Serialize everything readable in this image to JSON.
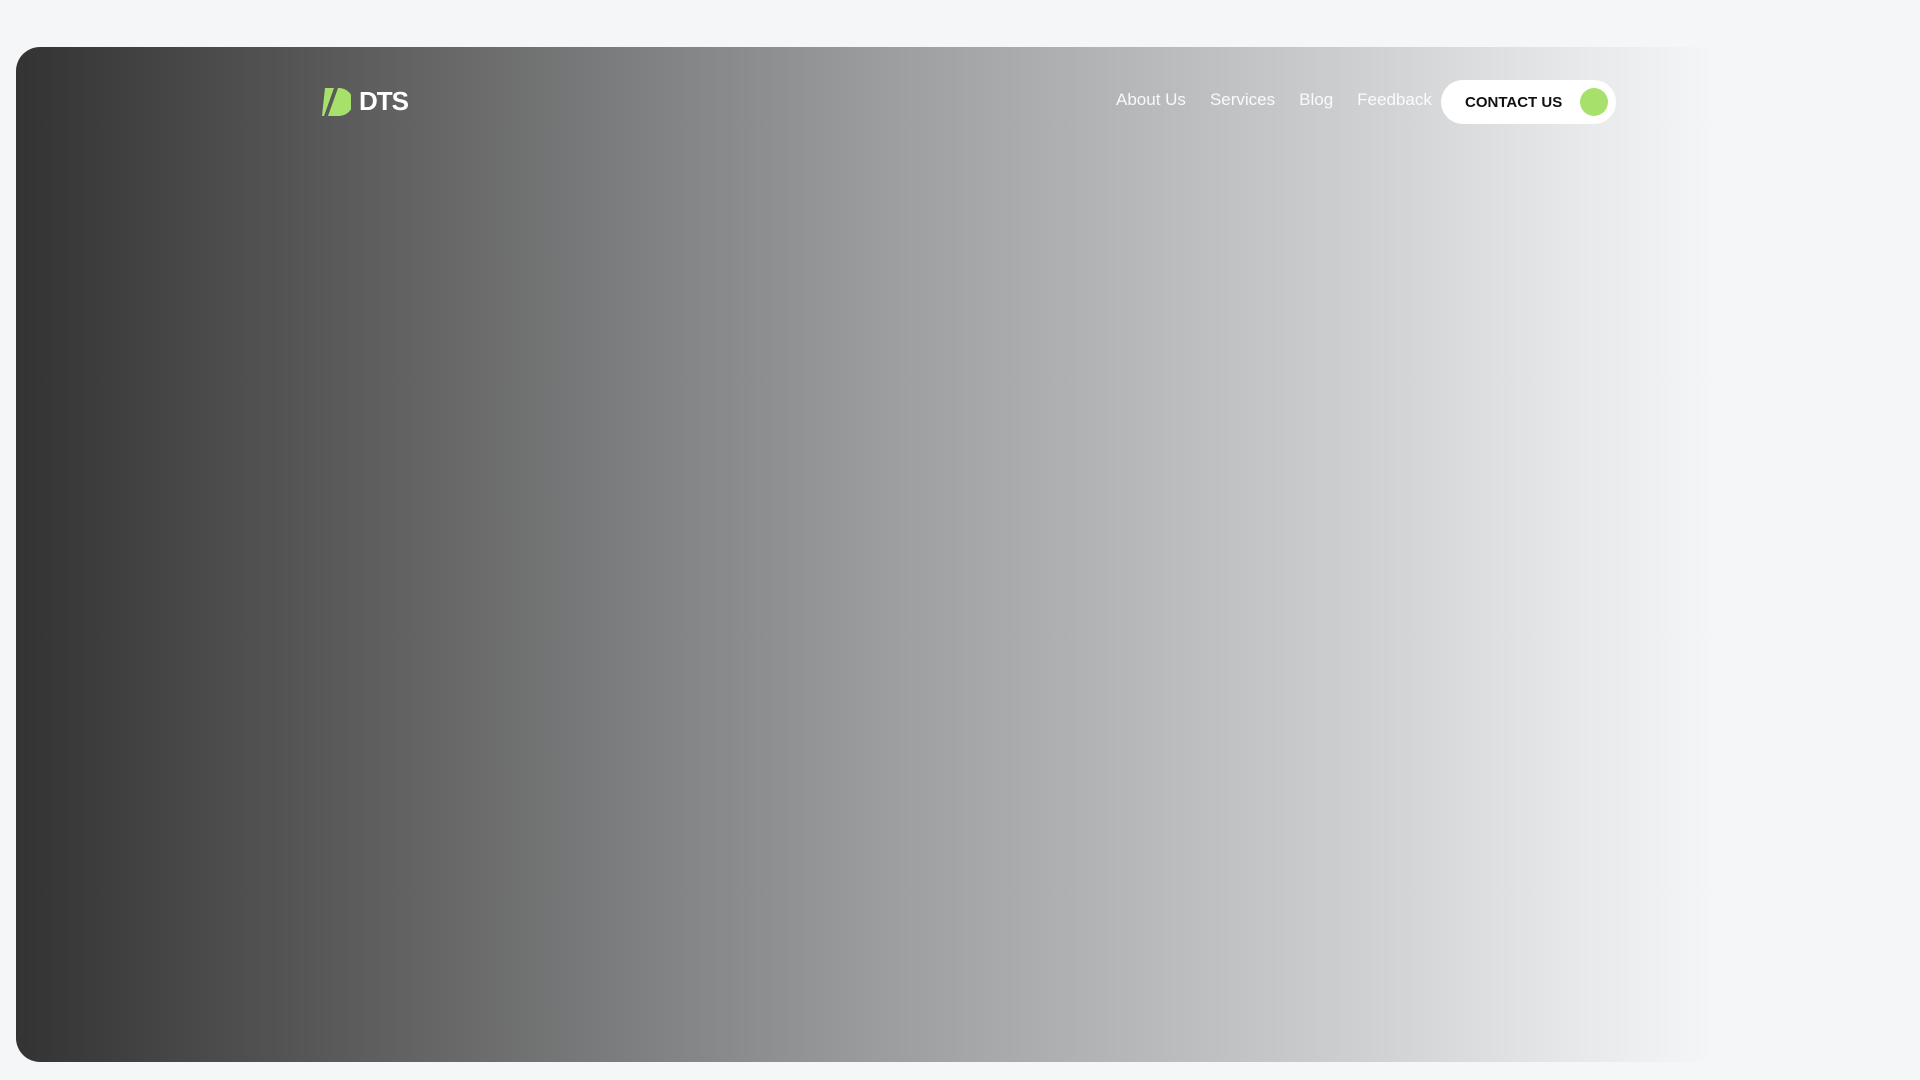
{
  "brand": {
    "name": "DTS",
    "accent": "#a8e06c"
  },
  "nav": {
    "items": [
      {
        "label": "About Us"
      },
      {
        "label": "Services"
      },
      {
        "label": "Blog"
      },
      {
        "label": "Feedback"
      }
    ]
  },
  "cta": {
    "label": "CONTACT US"
  }
}
